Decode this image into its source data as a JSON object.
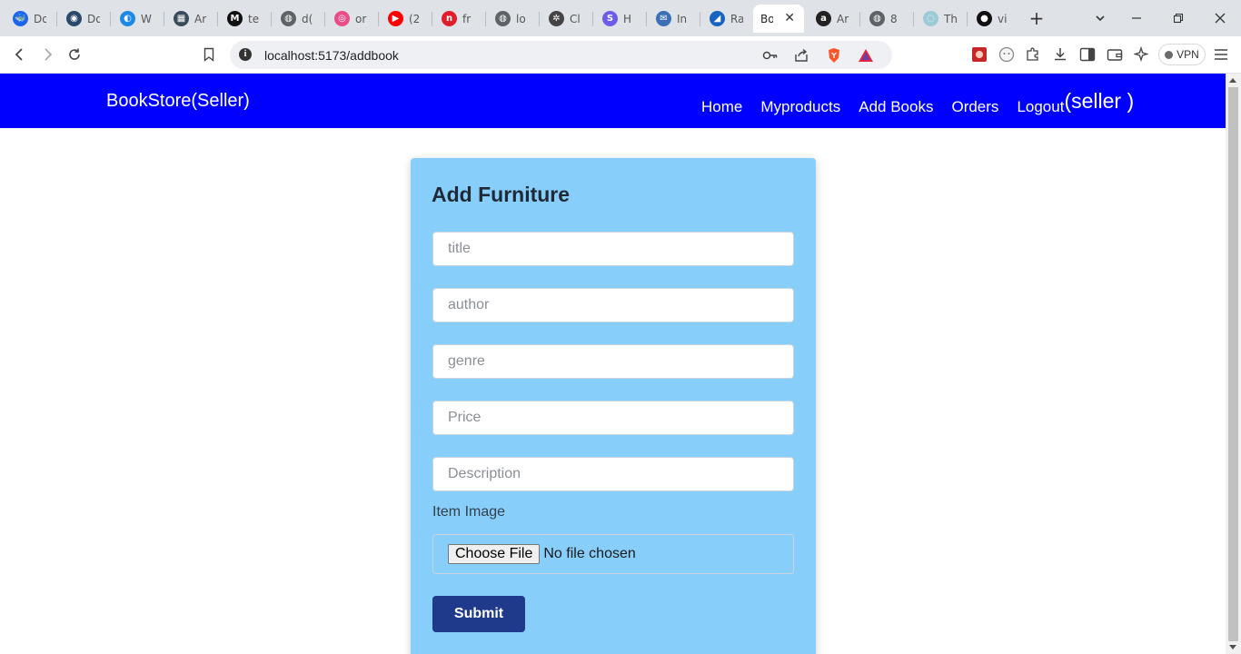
{
  "browser": {
    "tabs": [
      {
        "label": "Do",
        "fav_color": "#1d63ed",
        "glyph": "🐳"
      },
      {
        "label": "Do",
        "fav_color": "#2b4a6b",
        "glyph": "◉"
      },
      {
        "label": "W",
        "fav_color": "#1e88e5",
        "glyph": "◐"
      },
      {
        "label": "Ar",
        "fav_color": "#394b59",
        "glyph": "▦"
      },
      {
        "label": "te",
        "fav_color": "#111111",
        "glyph": "M"
      },
      {
        "label": "d(",
        "fav_color": "#5f6368",
        "glyph": "◍"
      },
      {
        "label": "or",
        "fav_color": "#ea4c89",
        "glyph": "◎"
      },
      {
        "label": "(2",
        "fav_color": "#ff0000",
        "glyph": "▶"
      },
      {
        "label": "fr",
        "fav_color": "#e01e2b",
        "glyph": "n"
      },
      {
        "label": "lo",
        "fav_color": "#5f6368",
        "glyph": "◍"
      },
      {
        "label": "Cl",
        "fav_color": "#444444",
        "glyph": "✲"
      },
      {
        "label": "H",
        "fav_color": "#6c5ce7",
        "glyph": "S"
      },
      {
        "label": "In",
        "fav_color": "#3c6fb5",
        "glyph": "✉"
      },
      {
        "label": "Ra",
        "fav_color": "#1565c0",
        "glyph": "◢"
      },
      {
        "label": "Bo",
        "fav_color": "#ffffff",
        "glyph": "",
        "active": true
      },
      {
        "label": "Ar",
        "fav_color": "#222222",
        "glyph": "a"
      },
      {
        "label": "8",
        "fav_color": "#5f6368",
        "glyph": "◍"
      },
      {
        "label": "Th",
        "fav_color": "#9ec9d6",
        "glyph": "◌"
      },
      {
        "label": "vi",
        "fav_color": "#111111",
        "glyph": "●"
      }
    ],
    "url": "localhost:5173/addbook",
    "vpn_label": "VPN"
  },
  "nav": {
    "brand": "BookStore(Seller)",
    "links": [
      "Home",
      "Myproducts",
      "Add Books",
      "Orders",
      "Logout"
    ],
    "seller_tag": "(seller )"
  },
  "form": {
    "heading": "Add Furniture",
    "placeholders": {
      "title": "title",
      "author": "author",
      "genre": "genre",
      "price": "Price",
      "description": "Description"
    },
    "image_label": "Item Image",
    "choose_file": "Choose File",
    "no_file": "No file chosen",
    "submit": "Submit"
  },
  "colors": {
    "nav_bg": "#0000ff",
    "card_bg": "#87cefa",
    "submit_bg": "#1f3a8a"
  }
}
